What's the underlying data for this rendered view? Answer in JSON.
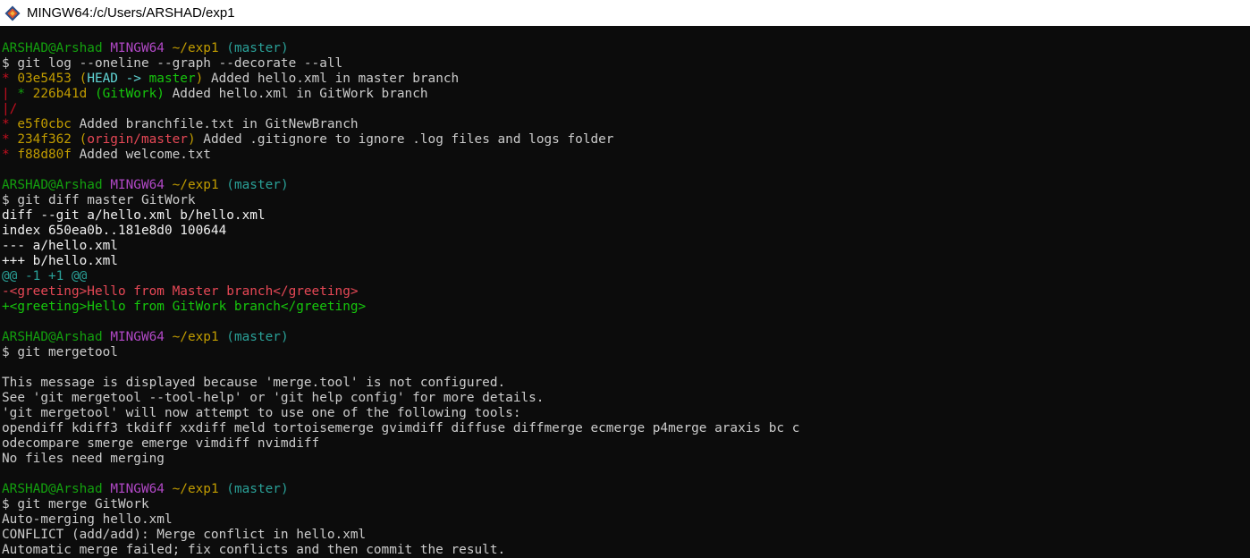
{
  "window": {
    "title": "MINGW64:/c/Users/ARSHAD/exp1"
  },
  "prompt": {
    "user_host": "ARSHAD@Arshad",
    "shell": "MINGW64",
    "path": "~/exp1",
    "branch": "(master)"
  },
  "cmd1": {
    "command": "$ git log --oneline --graph --decorate --all",
    "l1_star": "* ",
    "l1_hash": "03e5453",
    "l1_paren_open": " (",
    "l1_head": "HEAD -> ",
    "l1_master": "master",
    "l1_paren_close": ")",
    "l1_msg": " Added hello.xml in master branch",
    "l2_bar": "| ",
    "l2_star": "* ",
    "l2_hash": "226b41d",
    "l2_ref": " (GitWork)",
    "l2_msg": " Added hello.xml in GitWork branch",
    "l3_slash": "|/",
    "l4_star": "* ",
    "l4_hash": "e5f0cbc",
    "l4_msg": " Added branchfile.txt in GitNewBranch",
    "l5_star": "* ",
    "l5_hash": "234f362",
    "l5_paren_open": " (",
    "l5_ref": "origin/master",
    "l5_paren_close": ")",
    "l5_msg": " Added .gitignore to ignore .log files and logs folder",
    "l6_star": "* ",
    "l6_hash": "f88d80f",
    "l6_msg": " Added welcome.txt"
  },
  "cmd2": {
    "command": "$ git diff master GitWork",
    "diff_header": "diff --git a/hello.xml b/hello.xml",
    "index": "index 650ea0b..181e8d0 100644",
    "minus_file": "--- a/hello.xml",
    "plus_file": "+++ b/hello.xml",
    "hunk": "@@ -1 +1 @@",
    "removed": "-<greeting>Hello from Master branch</greeting>",
    "added": "+<greeting>Hello from GitWork branch</greeting>"
  },
  "cmd3": {
    "command": "$ git mergetool",
    "l1": "This message is displayed because 'merge.tool' is not configured.",
    "l2": "See 'git mergetool --tool-help' or 'git help config' for more details.",
    "l3": "'git mergetool' will now attempt to use one of the following tools:",
    "l4": "opendiff kdiff3 tkdiff xxdiff meld tortoisemerge gvimdiff diffuse diffmerge ecmerge p4merge araxis bc c",
    "l5": "odecompare smerge emerge vimdiff nvimdiff",
    "l6": "No files need merging"
  },
  "cmd4": {
    "command": "$ git merge GitWork",
    "l1": "Auto-merging hello.xml",
    "l2": "CONFLICT (add/add): Merge conflict in hello.xml",
    "l3": "Automatic merge failed; fix conflicts and then commit the result."
  }
}
